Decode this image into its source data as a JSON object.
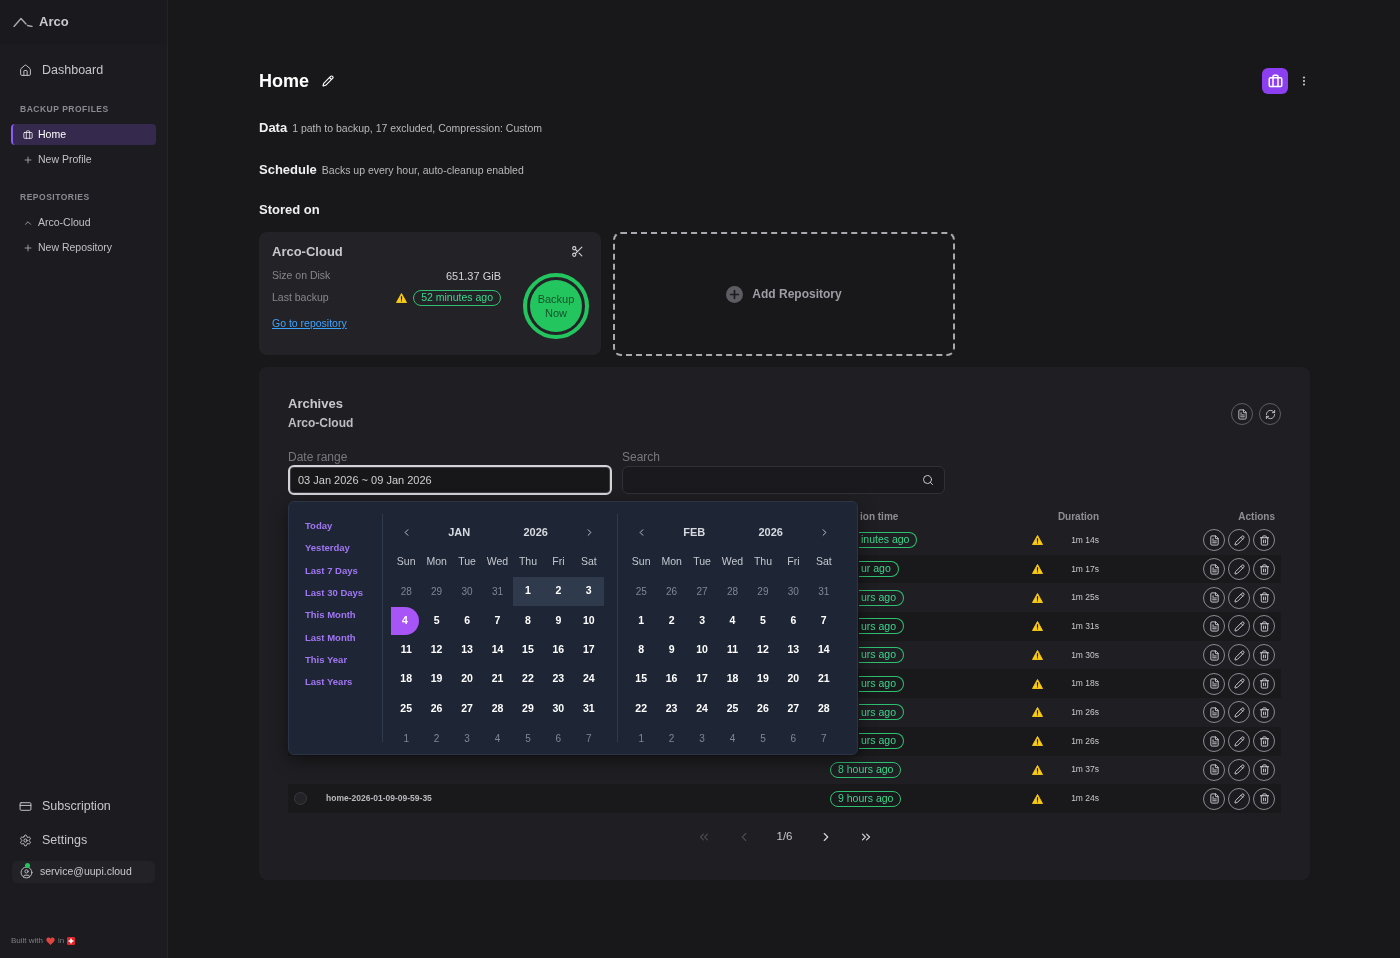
{
  "sidebar": {
    "brand": "Arco",
    "nav": [
      {
        "label": "Dashboard",
        "kind": "dashboard",
        "selected": false
      }
    ],
    "sections": [
      {
        "title": "BACKUP PROFILES",
        "items": [
          {
            "label": "Home",
            "kind": "profile",
            "selected": true
          },
          {
            "label": "New Profile",
            "kind": "add",
            "selected": false
          }
        ]
      },
      {
        "title": "REPOSITORIES",
        "items": [
          {
            "label": "Arco-Cloud",
            "kind": "repository",
            "selected": false
          },
          {
            "label": "New Repository",
            "kind": "add",
            "selected": false
          }
        ]
      }
    ],
    "bottom_nav": [
      {
        "label": "Subscription",
        "kind": "subscription",
        "selected": false
      },
      {
        "label": "Settings",
        "kind": "settings",
        "selected": false
      }
    ],
    "account": {
      "email": "service@uupi.cloud",
      "online": true
    },
    "footer": {
      "built_with": "Built with",
      "in": "in"
    }
  },
  "header": {
    "title": "Home"
  },
  "summary": [
    {
      "label": "Data",
      "text": "1 path to backup, 17 excluded, Compression: Custom"
    },
    {
      "label": "Schedule",
      "text": "Backs up every hour, auto-cleanup enabled"
    }
  ],
  "stored_on": {
    "title": "Stored on",
    "repository_card": {
      "name": "Arco-Cloud",
      "size_label": "Size on Disk",
      "size_value": "651.37 GiB",
      "last_backup_label": "Last backup",
      "last_backup_warning": true,
      "last_backup_value": "52 minutes ago",
      "link": "Go to repository",
      "backup_button": "Backup Now"
    },
    "add_repository": "Add Repository"
  },
  "archives": {
    "title": "Archives",
    "repository": "Arco-Cloud",
    "date_range": {
      "label": "Date range",
      "value": "03 Jan 2026 ~ 09 Jan 2026",
      "focused": true
    },
    "search": {
      "label": "Search"
    },
    "date_picker": {
      "presets": [
        "Today",
        "Yesterday",
        "Last 7 Days",
        "Last 30 Days",
        "This Month",
        "Last Month",
        "This Year",
        "Last Years"
      ],
      "calendars": [
        {
          "month": "JAN",
          "year": "2026",
          "weekdays": [
            "Sun",
            "Mon",
            "Tue",
            "Wed",
            "Thu",
            "Fri",
            "Sat"
          ],
          "weeks": [
            [
              {
                "day": "28",
                "outside": true,
                "in_range": false,
                "selected": false
              },
              {
                "day": "29",
                "outside": true,
                "in_range": false,
                "selected": false
              },
              {
                "day": "30",
                "outside": true,
                "in_range": false,
                "selected": false
              },
              {
                "day": "31",
                "outside": true,
                "in_range": false,
                "selected": false
              },
              {
                "day": "1",
                "outside": false,
                "in_range": true,
                "selected": false
              },
              {
                "day": "2",
                "outside": false,
                "in_range": true,
                "selected": false
              },
              {
                "day": "3",
                "outside": false,
                "in_range": true,
                "selected": false
              }
            ],
            [
              {
                "day": "4",
                "outside": false,
                "in_range": false,
                "selected": true
              },
              {
                "day": "5",
                "outside": false,
                "in_range": false,
                "selected": false
              },
              {
                "day": "6",
                "outside": false,
                "in_range": false,
                "selected": false
              },
              {
                "day": "7",
                "outside": false,
                "in_range": false,
                "selected": false
              },
              {
                "day": "8",
                "outside": false,
                "in_range": false,
                "selected": false
              },
              {
                "day": "9",
                "outside": false,
                "in_range": false,
                "selected": false
              },
              {
                "day": "10",
                "outside": false,
                "in_range": false,
                "selected": false
              }
            ],
            [
              {
                "day": "11",
                "outside": false,
                "in_range": false,
                "selected": false
              },
              {
                "day": "12",
                "outside": false,
                "in_range": false,
                "selected": false
              },
              {
                "day": "13",
                "outside": false,
                "in_range": false,
                "selected": false
              },
              {
                "day": "14",
                "outside": false,
                "in_range": false,
                "selected": false
              },
              {
                "day": "15",
                "outside": false,
                "in_range": false,
                "selected": false
              },
              {
                "day": "16",
                "outside": false,
                "in_range": false,
                "selected": false
              },
              {
                "day": "17",
                "outside": false,
                "in_range": false,
                "selected": false
              }
            ],
            [
              {
                "day": "18",
                "outside": false,
                "in_range": false,
                "selected": false
              },
              {
                "day": "19",
                "outside": false,
                "in_range": false,
                "selected": false
              },
              {
                "day": "20",
                "outside": false,
                "in_range": false,
                "selected": false
              },
              {
                "day": "21",
                "outside": false,
                "in_range": false,
                "selected": false
              },
              {
                "day": "22",
                "outside": false,
                "in_range": false,
                "selected": false
              },
              {
                "day": "23",
                "outside": false,
                "in_range": false,
                "selected": false
              },
              {
                "day": "24",
                "outside": false,
                "in_range": false,
                "selected": false
              }
            ],
            [
              {
                "day": "25",
                "outside": false,
                "in_range": false,
                "selected": false
              },
              {
                "day": "26",
                "outside": false,
                "in_range": false,
                "selected": false
              },
              {
                "day": "27",
                "outside": false,
                "in_range": false,
                "selected": false
              },
              {
                "day": "28",
                "outside": false,
                "in_range": false,
                "selected": false
              },
              {
                "day": "29",
                "outside": false,
                "in_range": false,
                "selected": false
              },
              {
                "day": "30",
                "outside": false,
                "in_range": false,
                "selected": false
              },
              {
                "day": "31",
                "outside": false,
                "in_range": false,
                "selected": false
              }
            ],
            [
              {
                "day": "1",
                "outside": true,
                "in_range": false,
                "selected": false
              },
              {
                "day": "2",
                "outside": true,
                "in_range": false,
                "selected": false
              },
              {
                "day": "3",
                "outside": true,
                "in_range": false,
                "selected": false
              },
              {
                "day": "4",
                "outside": true,
                "in_range": false,
                "selected": false
              },
              {
                "day": "5",
                "outside": true,
                "in_range": false,
                "selected": false
              },
              {
                "day": "6",
                "outside": true,
                "in_range": false,
                "selected": false
              },
              {
                "day": "7",
                "outside": true,
                "in_range": false,
                "selected": false
              }
            ]
          ]
        },
        {
          "month": "FEB",
          "year": "2026",
          "weekdays": [
            "Sun",
            "Mon",
            "Tue",
            "Wed",
            "Thu",
            "Fri",
            "Sat"
          ],
          "weeks": [
            [
              {
                "day": "25",
                "outside": true,
                "in_range": false,
                "selected": false
              },
              {
                "day": "26",
                "outside": true,
                "in_range": false,
                "selected": false
              },
              {
                "day": "27",
                "outside": true,
                "in_range": false,
                "selected": false
              },
              {
                "day": "28",
                "outside": true,
                "in_range": false,
                "selected": false
              },
              {
                "day": "29",
                "outside": true,
                "in_range": false,
                "selected": false
              },
              {
                "day": "30",
                "outside": true,
                "in_range": false,
                "selected": false
              },
              {
                "day": "31",
                "outside": true,
                "in_range": false,
                "selected": false
              }
            ],
            [
              {
                "day": "1",
                "outside": false,
                "in_range": false,
                "selected": false
              },
              {
                "day": "2",
                "outside": false,
                "in_range": false,
                "selected": false
              },
              {
                "day": "3",
                "outside": false,
                "in_range": false,
                "selected": false
              },
              {
                "day": "4",
                "outside": false,
                "in_range": false,
                "selected": false
              },
              {
                "day": "5",
                "outside": false,
                "in_range": false,
                "selected": false
              },
              {
                "day": "6",
                "outside": false,
                "in_range": false,
                "selected": false
              },
              {
                "day": "7",
                "outside": false,
                "in_range": false,
                "selected": false
              }
            ],
            [
              {
                "day": "8",
                "outside": false,
                "in_range": false,
                "selected": false
              },
              {
                "day": "9",
                "outside": false,
                "in_range": false,
                "selected": false
              },
              {
                "day": "10",
                "outside": false,
                "in_range": false,
                "selected": false
              },
              {
                "day": "11",
                "outside": false,
                "in_range": false,
                "selected": false
              },
              {
                "day": "12",
                "outside": false,
                "in_range": false,
                "selected": false
              },
              {
                "day": "13",
                "outside": false,
                "in_range": false,
                "selected": false
              },
              {
                "day": "14",
                "outside": false,
                "in_range": false,
                "selected": false
              }
            ],
            [
              {
                "day": "15",
                "outside": false,
                "in_range": false,
                "selected": false
              },
              {
                "day": "16",
                "outside": false,
                "in_range": false,
                "selected": false
              },
              {
                "day": "17",
                "outside": false,
                "in_range": false,
                "selected": false
              },
              {
                "day": "18",
                "outside": false,
                "in_range": false,
                "selected": false
              },
              {
                "day": "19",
                "outside": false,
                "in_range": false,
                "selected": false
              },
              {
                "day": "20",
                "outside": false,
                "in_range": false,
                "selected": false
              },
              {
                "day": "21",
                "outside": false,
                "in_range": false,
                "selected": false
              }
            ],
            [
              {
                "day": "22",
                "outside": false,
                "in_range": false,
                "selected": false
              },
              {
                "day": "23",
                "outside": false,
                "in_range": false,
                "selected": false
              },
              {
                "day": "24",
                "outside": false,
                "in_range": false,
                "selected": false
              },
              {
                "day": "25",
                "outside": false,
                "in_range": false,
                "selected": false
              },
              {
                "day": "26",
                "outside": false,
                "in_range": false,
                "selected": false
              },
              {
                "day": "27",
                "outside": false,
                "in_range": false,
                "selected": false
              },
              {
                "day": "28",
                "outside": false,
                "in_range": false,
                "selected": false
              }
            ],
            [
              {
                "day": "1",
                "outside": true,
                "in_range": false,
                "selected": false
              },
              {
                "day": "2",
                "outside": true,
                "in_range": false,
                "selected": false
              },
              {
                "day": "3",
                "outside": true,
                "in_range": false,
                "selected": false
              },
              {
                "day": "4",
                "outside": true,
                "in_range": false,
                "selected": false
              },
              {
                "day": "5",
                "outside": true,
                "in_range": false,
                "selected": false
              },
              {
                "day": "6",
                "outside": true,
                "in_range": false,
                "selected": false
              },
              {
                "day": "7",
                "outside": true,
                "in_range": false,
                "selected": false
              }
            ]
          ]
        }
      ]
    },
    "table": {
      "columns": [
        "ion time",
        "Duration",
        "Actions"
      ],
      "rows": [
        {
          "kind": "cut",
          "time": "inutes ago",
          "warning": true,
          "duration": "1m 14s"
        },
        {
          "kind": "cut",
          "time": "ur ago",
          "warning": true,
          "duration": "1m 17s"
        },
        {
          "kind": "cut",
          "time": "urs ago",
          "warning": true,
          "duration": "1m 25s"
        },
        {
          "kind": "cut",
          "time": "urs ago",
          "warning": true,
          "duration": "1m 31s"
        },
        {
          "kind": "cut",
          "time": "urs ago",
          "warning": true,
          "duration": "1m 30s"
        },
        {
          "kind": "cut",
          "time": "urs ago",
          "warning": true,
          "duration": "1m 18s"
        },
        {
          "kind": "cut",
          "time": "urs ago",
          "warning": true,
          "duration": "1m 26s"
        },
        {
          "kind": "cut",
          "time": "urs ago",
          "warning": true,
          "duration": "1m 26s"
        },
        {
          "kind": "full",
          "time": "8 hours ago",
          "warning": true,
          "duration": "1m 37s"
        },
        {
          "kind": "full",
          "name": "home-2026-01-09-09-59-35",
          "checked": false,
          "time": "9 hours ago",
          "warning": true,
          "duration": "1m 24s"
        }
      ]
    },
    "pagination": {
      "page_label": "1/6",
      "controls": [
        {
          "kind": "first",
          "disabled": true
        },
        {
          "kind": "prev",
          "disabled": true
        },
        {
          "kind": "next",
          "disabled": false
        },
        {
          "kind": "last",
          "disabled": false
        }
      ]
    }
  }
}
